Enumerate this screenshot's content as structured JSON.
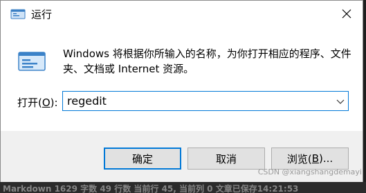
{
  "window": {
    "title": "运行"
  },
  "body": {
    "description": "Windows 将根据你所输入的名称，为你打开相应的程序、文件夹、文档或 Internet 资源。",
    "open_label_prefix": "打开(",
    "open_label_hotkey": "O",
    "open_label_suffix": "):",
    "command_value": "regedit"
  },
  "buttons": {
    "ok": "确定",
    "cancel": "取消",
    "browse_prefix": "浏览(",
    "browse_hotkey": "B",
    "browse_suffix": ")..."
  },
  "background": {
    "status_text": "Markdown  1629 字数  49 行数  当前行 45, 当前列 0  文章已保存14:21:53",
    "watermark": "CSDN @xiangshangdemayi"
  },
  "icons": {
    "title": "run-app-icon",
    "close": "close-icon",
    "dropdown": "chevron-down-icon",
    "body": "run-window-icon"
  },
  "colors": {
    "accent": "#0078d7",
    "dialog_bg": "#f0f0f0",
    "content_bg": "#ffffff",
    "button_bg": "#e1e1e1"
  }
}
